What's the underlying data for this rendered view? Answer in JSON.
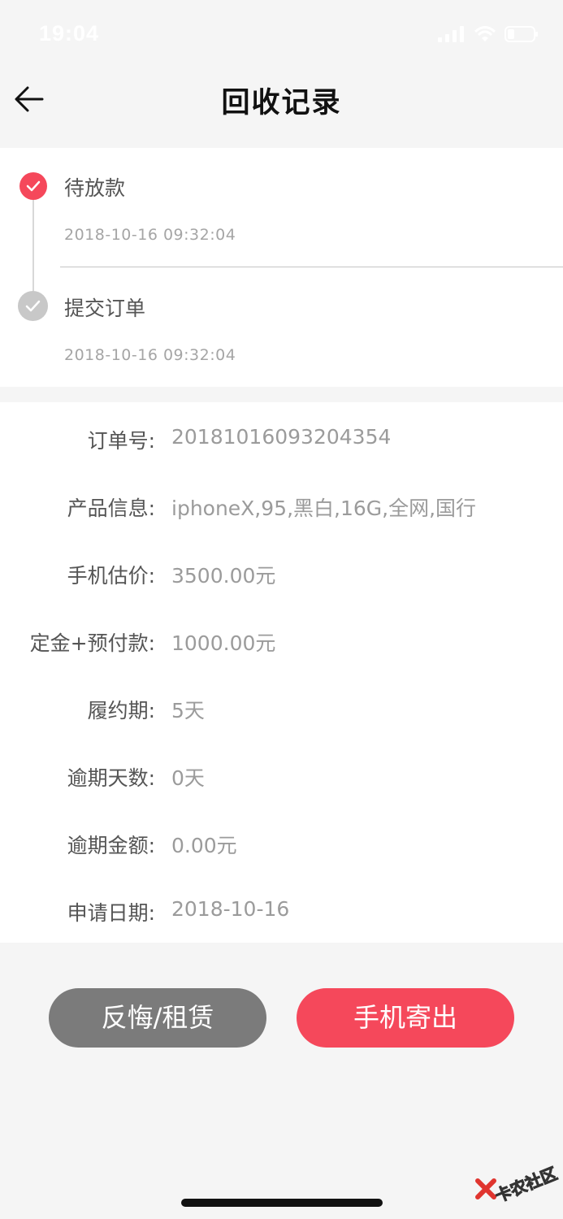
{
  "status_bar": {
    "time": "19:04"
  },
  "nav": {
    "title": "回收记录"
  },
  "timeline": [
    {
      "title": "待放款",
      "time": "2018-10-16 09:32:04",
      "state": "active"
    },
    {
      "title": "提交订单",
      "time": "2018-10-16 09:32:04",
      "state": "done"
    }
  ],
  "order_info": [
    {
      "label": "订单号:",
      "value": "20181016093204354"
    },
    {
      "label": "产品信息:",
      "value": "iphoneX,95,黑白,16G,全网,国行"
    },
    {
      "label": "手机估价:",
      "value": "3500.00元"
    },
    {
      "label": "定金+预付款:",
      "value": "1000.00元"
    },
    {
      "label": "履约期:",
      "value": "5天"
    },
    {
      "label": "逾期天数:",
      "value": "0天"
    },
    {
      "label": "逾期金额:",
      "value": "0.00元"
    },
    {
      "label": "申请日期:",
      "value": "2018-10-16"
    }
  ],
  "actions": {
    "secondary_label": "反悔/租赁",
    "primary_label": "手机寄出"
  },
  "watermark": {
    "text": "卡农社区"
  },
  "colors": {
    "accent": "#f5485b",
    "secondary_button": "#7b7b7b",
    "done_dot": "#c8c8c8"
  }
}
